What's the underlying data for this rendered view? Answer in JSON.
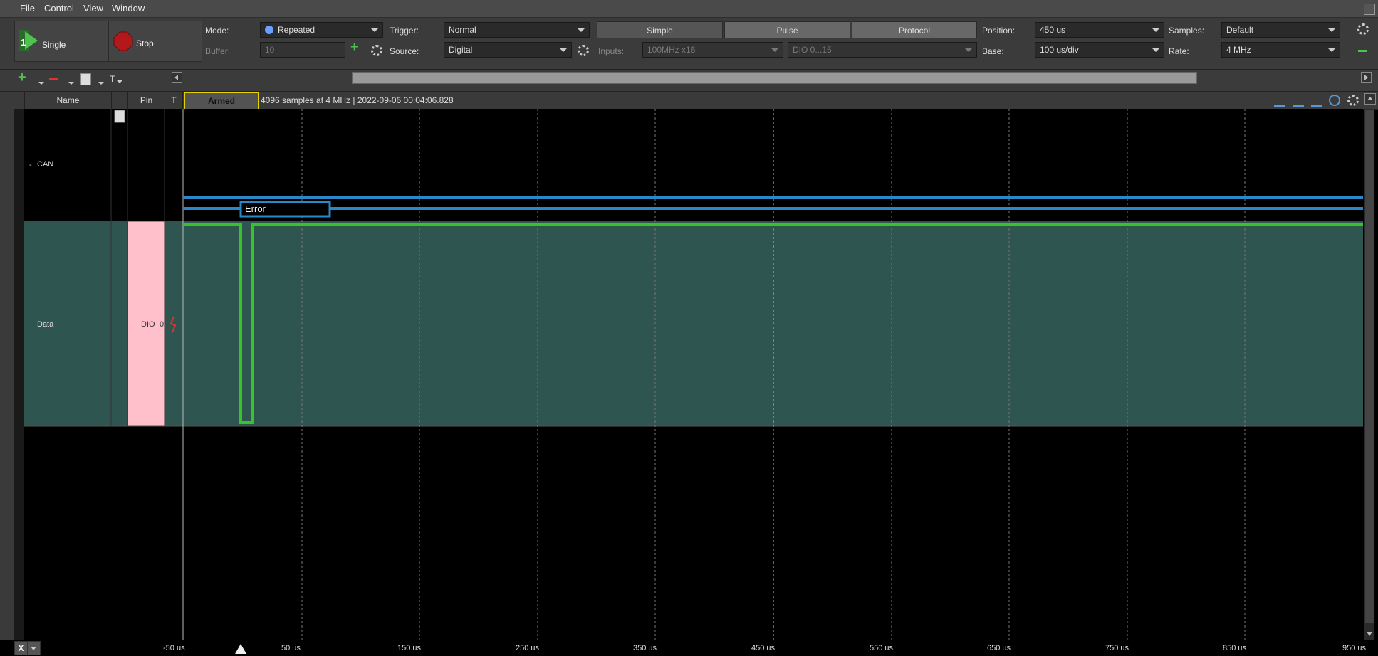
{
  "menu": [
    "File",
    "Control",
    "View",
    "Window"
  ],
  "run": {
    "single_label": "Single",
    "single_badge": "1",
    "stop_label": "Stop"
  },
  "mode": {
    "label": "Mode:",
    "value": "Repeated",
    "buffer_label": "Buffer:",
    "buffer_value": "10"
  },
  "trigger": {
    "label": "Trigger:",
    "value": "Normal",
    "source_label": "Source:",
    "source_value": "Digital"
  },
  "tabs": [
    "Simple",
    "Pulse",
    "Protocol"
  ],
  "inputs": {
    "label": "Inputs:",
    "value": "100MHz x16",
    "channels": "DIO 0...15"
  },
  "position": {
    "label": "Position:",
    "value": "450 us",
    "base_label": "Base:",
    "base_value": "100 us/div"
  },
  "samples": {
    "label": "Samples:",
    "value": "Default",
    "rate_label": "Rate:",
    "rate_value": "4 MHz"
  },
  "row2": {
    "t_label": "T"
  },
  "header": {
    "name": "Name",
    "pin": "Pin",
    "t": "T",
    "status": "Armed",
    "info": "4096 samples at 4 MHz | 2022-09-06 00:04:06.828"
  },
  "channels": [
    {
      "name": "CAN",
      "collapse": "-"
    },
    {
      "name": "Data",
      "pin": "DIO",
      "pin_num": "0"
    }
  ],
  "decode": {
    "label": "Error"
  },
  "axis": {
    "x_button": "X",
    "ticks": [
      "-50 us",
      "50 us",
      "150 us",
      "250 us",
      "350 us",
      "450 us",
      "550 us",
      "650 us",
      "750 us",
      "850 us",
      "950 us"
    ]
  },
  "colors": {
    "signal": "#39c32b",
    "bus": "#2b88c8",
    "armed_border": "#e6d200",
    "data_row": "#2f5550",
    "pin_cell": "#ffc0cb"
  }
}
